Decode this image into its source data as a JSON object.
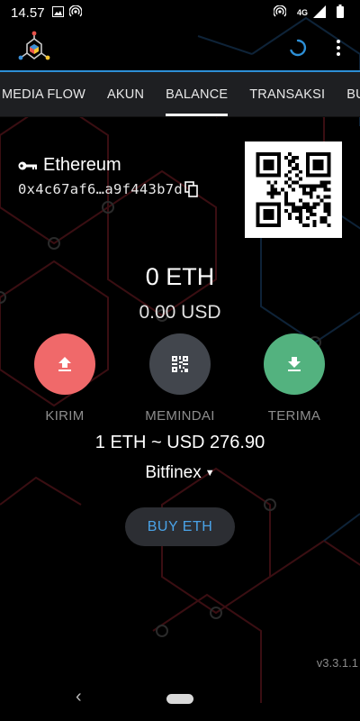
{
  "status_bar": {
    "time": "14.57",
    "network_label": "4G"
  },
  "tabs": [
    {
      "label": "MEDIA FLOW",
      "active": false
    },
    {
      "label": "AKUN",
      "active": false
    },
    {
      "label": "BALANCE",
      "active": true
    },
    {
      "label": "TRANSAKSI",
      "active": false
    },
    {
      "label": "BU",
      "active": false
    }
  ],
  "wallet": {
    "name": "Ethereum",
    "address": "0x4c67af6…a9f443b7d"
  },
  "balance": {
    "amount": "0 ETH",
    "fiat": "0.00 USD"
  },
  "actions": {
    "send_label": "KIRIM",
    "scan_label": "MEMINDAI",
    "receive_label": "TERIMA"
  },
  "rate": "1 ETH ~ USD 276.90",
  "exchange": "Bitfinex",
  "buy_label": "BUY ETH",
  "version": "v3.3.1.1",
  "colors": {
    "accent": "#2d8fd6",
    "send": "#f0696a",
    "scan": "#42464d",
    "receive": "#53b27f",
    "buy_text": "#4aa3e8"
  },
  "icons": {
    "logo": "mycelium-logo-icon",
    "key": "key-icon",
    "copy": "copy-icon",
    "send": "upload-icon",
    "scan": "qr-scan-icon",
    "receive": "download-icon"
  }
}
